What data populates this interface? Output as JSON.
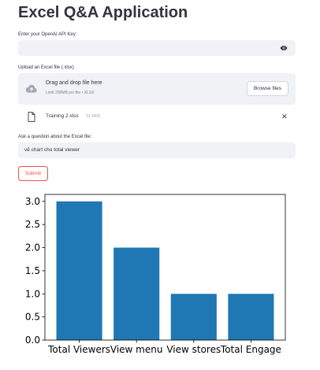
{
  "app": {
    "title": "Excel Q&A Application"
  },
  "api_key": {
    "label": "Enter your OpenAI API Key:",
    "value": "",
    "toggle_icon": "eye-icon"
  },
  "upload": {
    "label": "Upload an Excel file (.xlsx)",
    "drag_text": "Drag and drop file here",
    "limit_text": "Limit 200MB per file • XLSX",
    "browse_label": "Browse files",
    "icon": "cloud-upload-icon",
    "file": {
      "name": "Training 2.xlsx",
      "size": "21.5KB",
      "icon": "file-icon",
      "remove_icon": "close-icon"
    }
  },
  "question": {
    "label": "Ask a question about the Excel file:",
    "value": "vẽ chart cho total viewer"
  },
  "submit": {
    "label": "Submit",
    "accent_color": "#ff4b4b"
  },
  "chart_data": {
    "type": "bar",
    "categories": [
      "Total Viewers",
      "View menu",
      "View stores",
      "Total Engage"
    ],
    "values": [
      3,
      2,
      1,
      1
    ],
    "ylim": [
      0,
      3.15
    ],
    "yticks": [
      "0.0",
      "0.5",
      "1.0",
      "1.5",
      "2.0",
      "2.5",
      "3.0"
    ],
    "bar_color": "#1f77b4",
    "grid": false
  }
}
